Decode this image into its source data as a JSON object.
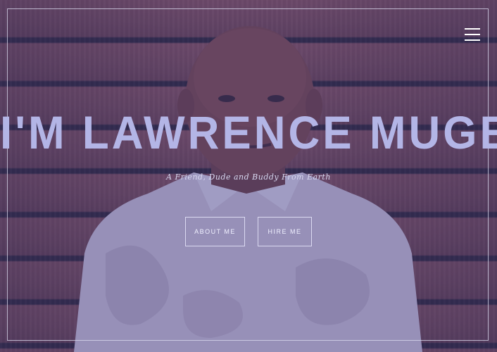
{
  "hero": {
    "title": "I'M LAWRENCE MUGERI",
    "subtitle": "A Friend, Dude and Buddy From Earth",
    "buttons": {
      "about_label": "ABOUT ME",
      "hire_label": "HIRE ME"
    }
  },
  "nav": {
    "menu_icon": "hamburger-menu-icon"
  },
  "colors": {
    "overlay": "#4848a0",
    "title": "#b3b5e6",
    "frame": "#dcdcf0"
  }
}
